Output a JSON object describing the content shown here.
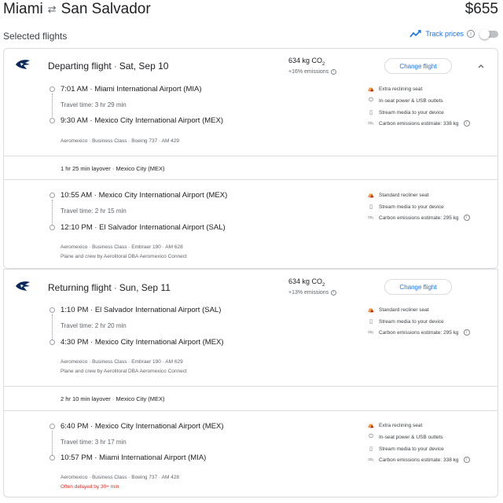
{
  "header": {
    "origin": "Miami",
    "destination": "San Salvador",
    "price": "$655"
  },
  "selected_label": "Selected flights",
  "track": {
    "label": "Track prices"
  },
  "departing": {
    "label": "Departing flight",
    "date": "Sat, Sep 10",
    "co2": "634 kg CO",
    "co2_sub": "2",
    "emissions": "+16% emissions",
    "change_label": "Change flight",
    "seg1": {
      "dep_time": "7:01 AM",
      "dep_airport": "Miami International Airport (MIA)",
      "travel_time": "Travel time: 3 hr 29 min",
      "arr_time": "9:30 AM",
      "arr_airport": "Mexico City International Airport (MEX)",
      "meta": "Aeromexico · Business Class · Boeing 737 · AM 429",
      "amenities": [
        "Extra reclining seat",
        "In-seat power & USB outlets",
        "Stream media to your device",
        "Carbon emissions estimate: 338 kg"
      ]
    },
    "layover": "1 hr 25 min layover · Mexico City (MEX)",
    "seg2": {
      "dep_time": "10:55 AM",
      "dep_airport": "Mexico City International Airport (MEX)",
      "travel_time": "Travel time: 2 hr 15 min",
      "arr_time": "12:10 PM",
      "arr_airport": "El Salvador International Airport (SAL)",
      "meta": "Aeromexico · Business Class · Embraer 190 · AM 628",
      "meta2": "Plane and crew by Aerolitoral DBA Aeromexico Connect",
      "amenities": [
        "Standard recliner seat",
        "Stream media to your device",
        "Carbon emissions estimate: 295 kg"
      ]
    }
  },
  "returning": {
    "label": "Returning flight",
    "date": "Sun, Sep 11",
    "co2": "634 kg CO",
    "co2_sub": "2",
    "emissions": "+13% emissions",
    "change_label": "Change flight",
    "seg1": {
      "dep_time": "1:10 PM",
      "dep_airport": "El Salvador International Airport (SAL)",
      "travel_time": "Travel time: 2 hr 20 min",
      "arr_time": "4:30 PM",
      "arr_airport": "Mexico City International Airport (MEX)",
      "meta": "Aeromexico · Business Class · Embraer 190 · AM 629",
      "meta2": "Plane and crew by Aerolitoral DBA Aeromexico Connect",
      "amenities": [
        "Standard recliner seat",
        "Stream media to your device",
        "Carbon emissions estimate: 295 kg"
      ]
    },
    "layover": "2 hr 10 min layover · Mexico City (MEX)",
    "seg2": {
      "dep_time": "6:40 PM",
      "dep_airport": "Mexico City International Airport (MEX)",
      "travel_time": "Travel time: 3 hr 17 min",
      "arr_time": "10:57 PM",
      "arr_airport": "Miami International Airport (MIA)",
      "meta": "Aeromexico · Business Class · Boeing 737 · AM 428",
      "warning": "Often delayed by 30+ min",
      "amenities": [
        "Extra reclining seat",
        "In-seat power & USB outlets",
        "Stream media to your device",
        "Carbon emissions estimate: 338 kg"
      ]
    }
  },
  "colors": {
    "accent": "#1a73e8",
    "warning": "#d93025",
    "border": "#dadce0",
    "muted": "#5f6368"
  },
  "icons": [
    "swap-icon",
    "trend-icon",
    "info-icon",
    "airline-logo-icon",
    "chevron-up-icon",
    "seat-icon",
    "power-icon",
    "media-icon",
    "co2-icon"
  ]
}
